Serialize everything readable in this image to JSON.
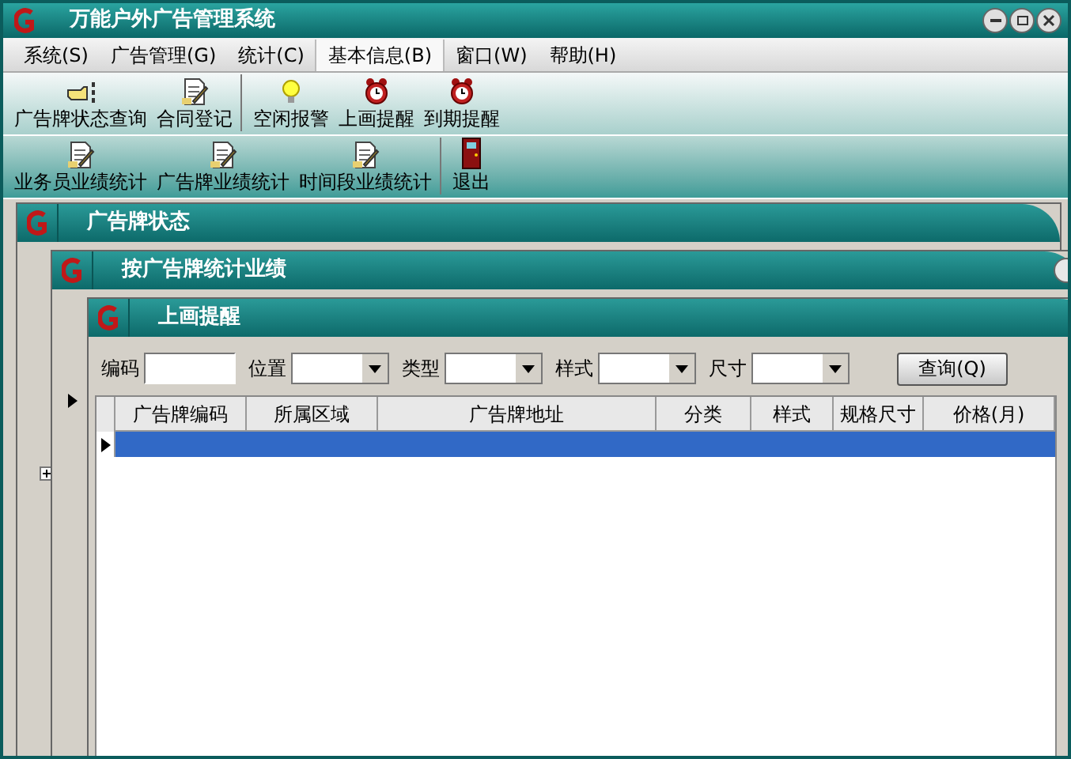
{
  "window": {
    "title": "万能户外广告管理系统"
  },
  "menu": [
    {
      "label": "系统(S)",
      "selected": false
    },
    {
      "label": "广告管理(G)",
      "selected": false
    },
    {
      "label": "统计(C)",
      "selected": false
    },
    {
      "label": "基本信息(B)",
      "selected": true
    },
    {
      "label": "窗口(W)",
      "selected": false
    },
    {
      "label": "帮助(H)",
      "selected": false
    }
  ],
  "toolbars": [
    [
      [
        {
          "label": "广告牌状态查询",
          "kind": "hand"
        },
        {
          "label": "合同登记",
          "kind": "doc"
        }
      ],
      [
        {
          "label": "空闲报警",
          "kind": "bulb"
        },
        {
          "label": "上画提醒",
          "kind": "clock"
        },
        {
          "label": "到期提醒",
          "kind": "clock"
        }
      ]
    ],
    [
      [
        {
          "label": "业务员业绩统计",
          "kind": "doc"
        },
        {
          "label": "广告牌业绩统计",
          "kind": "doc"
        },
        {
          "label": "时间段业绩统计",
          "kind": "doc"
        }
      ],
      [
        {
          "label": "退出",
          "kind": "door"
        }
      ]
    ]
  ],
  "child_windows": [
    {
      "title": "广告牌状态"
    },
    {
      "title": "按广告牌统计业绩"
    },
    {
      "title": "上画提醒"
    }
  ],
  "filters": [
    {
      "label": "编码",
      "kind": "text"
    },
    {
      "label": "位置",
      "kind": "combo"
    },
    {
      "label": "类型",
      "kind": "combo"
    },
    {
      "label": "样式",
      "kind": "combo"
    },
    {
      "label": "尺寸",
      "kind": "combo"
    }
  ],
  "query_button": "查询(Q)",
  "table": {
    "columns": [
      "广告牌编码",
      "所属区域",
      "广告牌地址",
      "分类",
      "样式",
      "规格尺寸",
      "价格(月)"
    ],
    "rows": [
      {
        "selected": true
      }
    ]
  }
}
